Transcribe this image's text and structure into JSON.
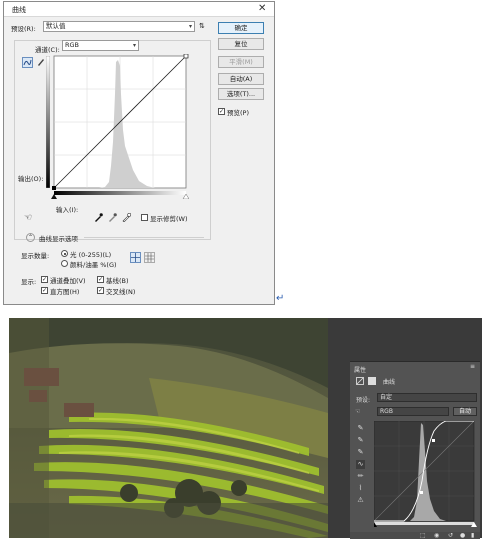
{
  "dialog": {
    "title": "曲线",
    "close": "✕",
    "preset_label": "预设(R):",
    "preset_value": "默认值",
    "channel_label": "通道(C):",
    "channel_value": "RGB",
    "output_label": "输出(O):",
    "input_label": "输入(I):",
    "show_clipping_label": "显示修剪(W)",
    "display_options_label": "曲线显示选项",
    "show_amount_label": "显示数量:",
    "light_option": "光 (0-255)(L)",
    "pigment_option": "颜料/油墨 %(G)",
    "show_label": "显示:",
    "channel_overlays": "通道叠加(V)",
    "baseline": "基线(B)",
    "histogram": "直方图(H)",
    "intersection": "交叉线(N)",
    "buttons": {
      "ok": "确定",
      "reset": "复位",
      "smooth": "平滑(M)",
      "auto": "自动(A)",
      "options": "选项(T)..."
    },
    "preview_label": "预览(P)",
    "preview_checked": true
  },
  "panel": {
    "header": "属性",
    "type_label": "曲线",
    "preset_label": "预设:",
    "preset_value": "自定",
    "channel_value": "RGB",
    "auto_button": "自动"
  },
  "icons": {
    "pencil": "pencil-icon",
    "curve": "curve-icon",
    "hand": "hand-icon",
    "eyedroppers": [
      "black-eyedropper-icon",
      "gray-eyedropper-icon",
      "white-eyedropper-icon"
    ]
  },
  "marks": {
    "return_arrow": "↵",
    "check": "✓",
    "dropdown": "▾"
  }
}
